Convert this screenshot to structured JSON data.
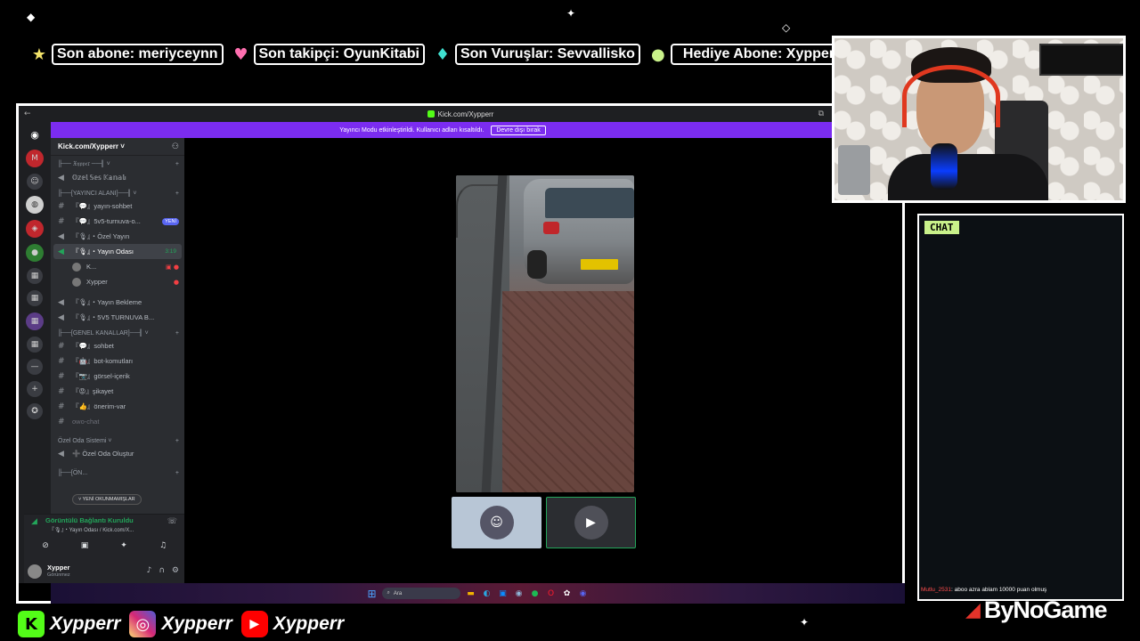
{
  "ticker": [
    {
      "icon": "star-icon",
      "icon_glyph": "★",
      "icon_color": "#f3e36a",
      "text": "Son abone: meriyceynn"
    },
    {
      "icon": "heart-icon",
      "icon_glyph": "♥",
      "icon_color": "#ff6fb0",
      "text": "Son takipçi: OyunKitabi"
    },
    {
      "icon": "diamond-icon",
      "icon_glyph": "♦",
      "icon_color": "#3fe0d0",
      "text": "Son Vuruşlar: Sevvallisko"
    },
    {
      "icon": "coin-icon",
      "icon_glyph": "●",
      "icon_color": "#c9f18a",
      "text": "Hediye Abone: Xypperr"
    }
  ],
  "browser": {
    "title": "Kick.com/Xypperr",
    "back_glyph": "←",
    "window_glyph": "⧉"
  },
  "banner": {
    "text": "Yayıncı Modu etkinleştirildi. Kullanıcı adları kısaltıldı.",
    "button": "Devre dışı bırak"
  },
  "rail": [
    {
      "name": "discord-home-icon",
      "glyph": "◉",
      "style": "discord"
    },
    {
      "name": "server-icon-m",
      "glyph": "M",
      "style": "red"
    },
    {
      "name": "server-icon-avatar",
      "glyph": "☺",
      "style": "small"
    },
    {
      "name": "server-icon-mask",
      "glyph": "◍",
      "style": "white"
    },
    {
      "name": "server-icon-red",
      "glyph": "◈",
      "style": "red"
    },
    {
      "name": "server-icon-green",
      "glyph": "●",
      "style": "green"
    },
    {
      "name": "server-icon-folder-1",
      "glyph": "▦",
      "style": "small"
    },
    {
      "name": "server-icon-folder-2",
      "glyph": "▦",
      "style": "small"
    },
    {
      "name": "server-icon-folder-3",
      "glyph": "▦",
      "style": "purple"
    },
    {
      "name": "server-icon-folder-4",
      "glyph": "▦",
      "style": "small"
    },
    {
      "name": "server-icon-line",
      "glyph": "—",
      "style": "small"
    },
    {
      "name": "add-server-icon",
      "glyph": "+",
      "style": "small"
    },
    {
      "name": "explore-icon",
      "glyph": "✪",
      "style": "small"
    }
  ],
  "server": {
    "name": "Kick.com/Xypperr ˅",
    "invite_glyph": "⚇"
  },
  "channels": {
    "cat1": {
      "label": "╟── 𝔛𝔶𝔭𝔭𝔢𝔯 ──╢ ˅",
      "plus": "+"
    },
    "cat1_items": [
      {
        "glyph": "🔊",
        "label": "𝕆𝕫𝕖𝕝 𝕊𝕖𝕤 𝕂𝕒𝕟𝕒𝕝ı"
      }
    ],
    "cat2": {
      "label": "╟──[YAYINCI ALANI]──╢ ˅",
      "plus": "+"
    },
    "cat2_items": [
      {
        "glyph": "#",
        "label": "『💬』yayın-sohbet",
        "badge": "",
        "time": ""
      },
      {
        "glyph": "#",
        "label": "『💬』5v5-turnuva-o...",
        "badge": "YENİ",
        "time": ""
      },
      {
        "glyph": "🔊",
        "label": "『🎙』・Özel Yayın",
        "badge": "",
        "time": ""
      },
      {
        "glyph": "🔊",
        "label": "『🎙』・Yayın Odası",
        "badge": "",
        "time": "3:19"
      }
    ],
    "users": [
      {
        "name": "K...",
        "icons": "▣ ●"
      },
      {
        "name": "Xypper",
        "icons": "●"
      }
    ],
    "cat2_more": [
      {
        "glyph": "🔊",
        "label": "『🎙』・Yayın Bekleme"
      },
      {
        "glyph": "🔊",
        "label": "『🎙』・5V5 TURNUVA B..."
      }
    ],
    "cat3": {
      "label": "╟──[GENEL KANALLAR]──╢ ˅",
      "plus": "+"
    },
    "cat3_items": [
      {
        "glyph": "#",
        "label": "『💬』sohbet"
      },
      {
        "glyph": "#",
        "label": "『🤖』bot-komutları"
      },
      {
        "glyph": "#",
        "label": "『📷』görsel-içerik"
      },
      {
        "glyph": "#",
        "label": "『😡』şikayet"
      },
      {
        "glyph": "#",
        "label": "『👍』önerim-var"
      },
      {
        "glyph": "#",
        "label": "owo-chat"
      }
    ],
    "cat4": {
      "label": "Özel Oda Sistemi ˅",
      "plus": "+"
    },
    "cat4_items": [
      {
        "glyph": "🔊",
        "label": "➕ Özel Oda Oluştur"
      }
    ],
    "cat5": {
      "label": "╟──[ÖN...",
      "plus": "+"
    }
  },
  "unread_pill": "˅ YENİ OKUNMAMIŞLAR",
  "voice": {
    "status": "Görüntülü Bağlantı Kuruldu",
    "sub": "『🎙』・Yayın Odası / Kick.com/X...",
    "signal_glyph": "📶",
    "end_glyph": "☏",
    "buttons": [
      {
        "name": "camera-off-button",
        "glyph": "⊘"
      },
      {
        "name": "screen-share-button",
        "glyph": "▣"
      },
      {
        "name": "activities-button",
        "glyph": "✦"
      },
      {
        "name": "soundboard-button",
        "glyph": "♫"
      }
    ]
  },
  "user": {
    "name": "Xypper",
    "status": "Görünmez",
    "mic_glyph": "🎤",
    "headphone_glyph": "🎧",
    "settings_glyph": "⚙"
  },
  "thumbs": [
    {
      "name": "participant-thumb-1",
      "glyph": "☺"
    },
    {
      "name": "participant-thumb-2",
      "glyph": "▶"
    }
  ],
  "taskbar": {
    "start_glyph": "⊞",
    "search": "Ara",
    "search_glyph": "⌕",
    "apps": [
      {
        "name": "file-explorer-icon",
        "glyph": "▬",
        "color": "#f3b300"
      },
      {
        "name": "edge-icon",
        "glyph": "◐",
        "color": "#2aa6e0"
      },
      {
        "name": "store-icon",
        "glyph": "▣",
        "color": "#0a8cff"
      },
      {
        "name": "steam-icon",
        "glyph": "◉",
        "color": "#1b2838"
      },
      {
        "name": "spotify-icon",
        "glyph": "●",
        "color": "#1db954"
      },
      {
        "name": "opera-icon",
        "glyph": "O",
        "color": "#ff1b2d"
      },
      {
        "name": "chatgpt-icon",
        "glyph": "✿",
        "color": "#ffffff"
      },
      {
        "name": "discord-icon",
        "glyph": "◉",
        "color": "#5865f2"
      }
    ]
  },
  "chat": {
    "header": "CHAT",
    "message_user": "Mutlu_2531",
    "message_text": ": aboo azra ablam 10000 puan olmuş"
  },
  "socials": [
    {
      "name": "kick",
      "glyph": "K",
      "handle": "Xypperr"
    },
    {
      "name": "instagram",
      "glyph": "◎",
      "handle": "Xypperr"
    },
    {
      "name": "youtube",
      "glyph": "▶",
      "handle": "Xypperr"
    }
  ],
  "brand": {
    "glyph": "◢",
    "text": "ByNoGame"
  }
}
